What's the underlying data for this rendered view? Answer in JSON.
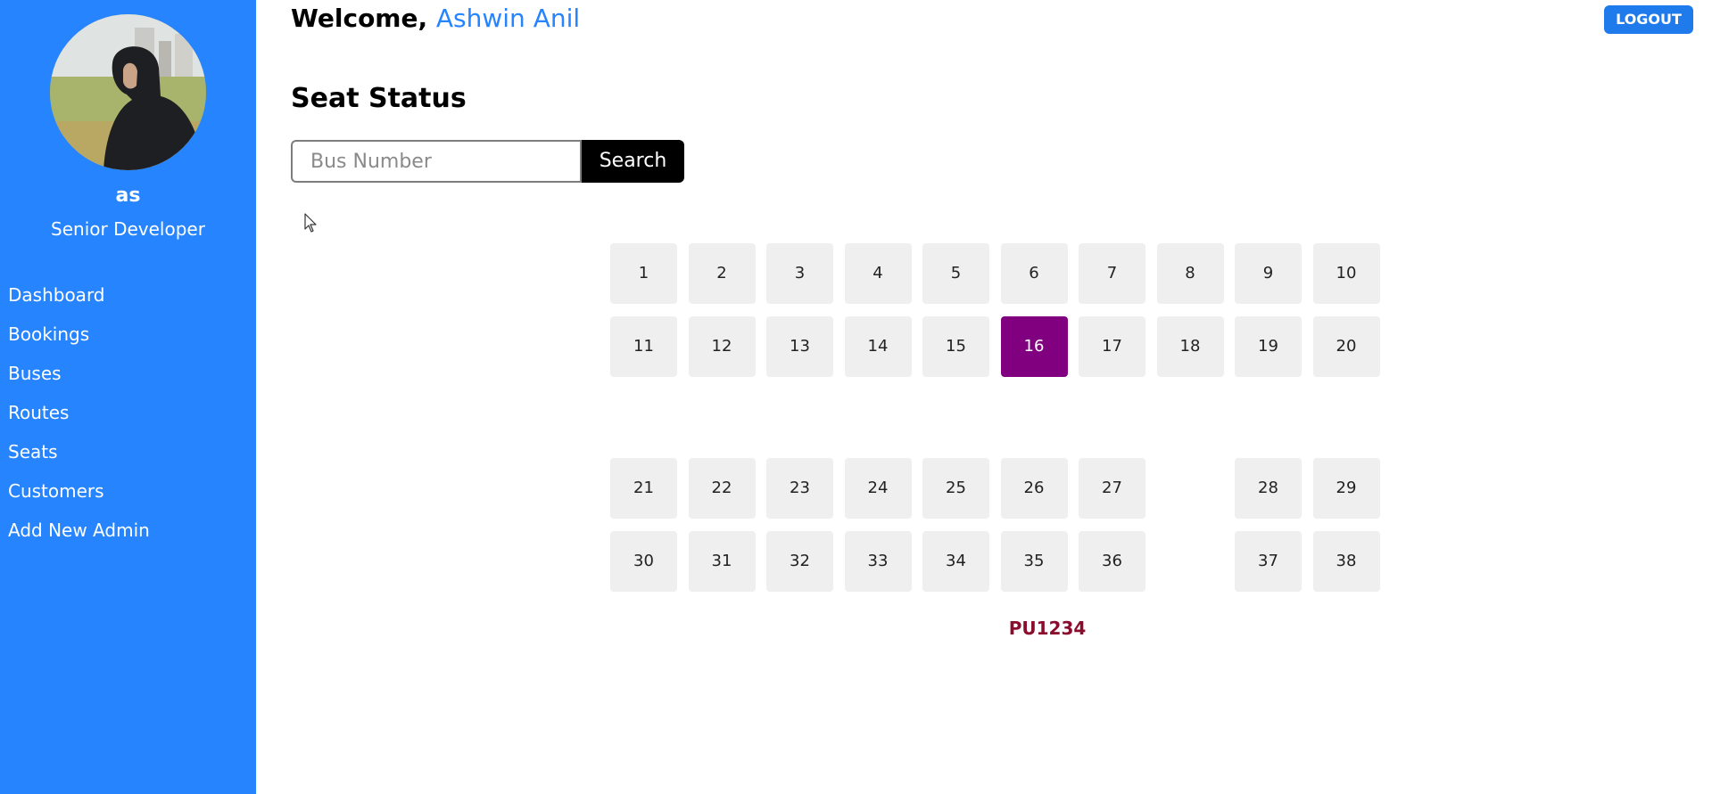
{
  "sidebar": {
    "profile": {
      "name": "as",
      "role": "Senior Developer"
    },
    "nav": [
      {
        "label": "Dashboard"
      },
      {
        "label": "Bookings"
      },
      {
        "label": "Buses"
      },
      {
        "label": "Routes"
      },
      {
        "label": "Seats"
      },
      {
        "label": "Customers"
      },
      {
        "label": "Add New Admin"
      }
    ]
  },
  "header": {
    "welcome_prefix": "Welcome,",
    "user_name": "Ashwin Anil",
    "logout_label": "LOGOUT"
  },
  "main": {
    "title": "Seat Status",
    "search": {
      "placeholder": "Bus Number",
      "value": "",
      "button_label": "Search"
    },
    "seats": [
      {
        "number": "1",
        "booked": false
      },
      {
        "number": "2",
        "booked": false
      },
      {
        "number": "3",
        "booked": false
      },
      {
        "number": "4",
        "booked": false
      },
      {
        "number": "5",
        "booked": false
      },
      {
        "number": "6",
        "booked": false
      },
      {
        "number": "7",
        "booked": false
      },
      {
        "number": "8",
        "booked": false
      },
      {
        "number": "9",
        "booked": false
      },
      {
        "number": "10",
        "booked": false
      },
      {
        "number": "11",
        "booked": false
      },
      {
        "number": "12",
        "booked": false
      },
      {
        "number": "13",
        "booked": false
      },
      {
        "number": "14",
        "booked": false
      },
      {
        "number": "15",
        "booked": false
      },
      {
        "number": "16",
        "booked": true
      },
      {
        "number": "17",
        "booked": false
      },
      {
        "number": "18",
        "booked": false
      },
      {
        "number": "19",
        "booked": false
      },
      {
        "number": "20",
        "booked": false
      },
      {
        "number": "21",
        "booked": false
      },
      {
        "number": "22",
        "booked": false
      },
      {
        "number": "23",
        "booked": false
      },
      {
        "number": "24",
        "booked": false
      },
      {
        "number": "25",
        "booked": false
      },
      {
        "number": "26",
        "booked": false
      },
      {
        "number": "27",
        "booked": false
      },
      {
        "number": "28",
        "booked": false
      },
      {
        "number": "29",
        "booked": false
      },
      {
        "number": "30",
        "booked": false
      },
      {
        "number": "31",
        "booked": false
      },
      {
        "number": "32",
        "booked": false
      },
      {
        "number": "33",
        "booked": false
      },
      {
        "number": "34",
        "booked": false
      },
      {
        "number": "35",
        "booked": false
      },
      {
        "number": "36",
        "booked": false
      },
      {
        "number": "37",
        "booked": false
      },
      {
        "number": "38",
        "booked": false
      }
    ],
    "bus_number": "PU1234"
  },
  "colors": {
    "sidebar": "#2684ff",
    "accent": "#2684ff",
    "booked_seat": "#800080",
    "available_seat": "#efefef",
    "bus_label": "#8b0d2e"
  }
}
